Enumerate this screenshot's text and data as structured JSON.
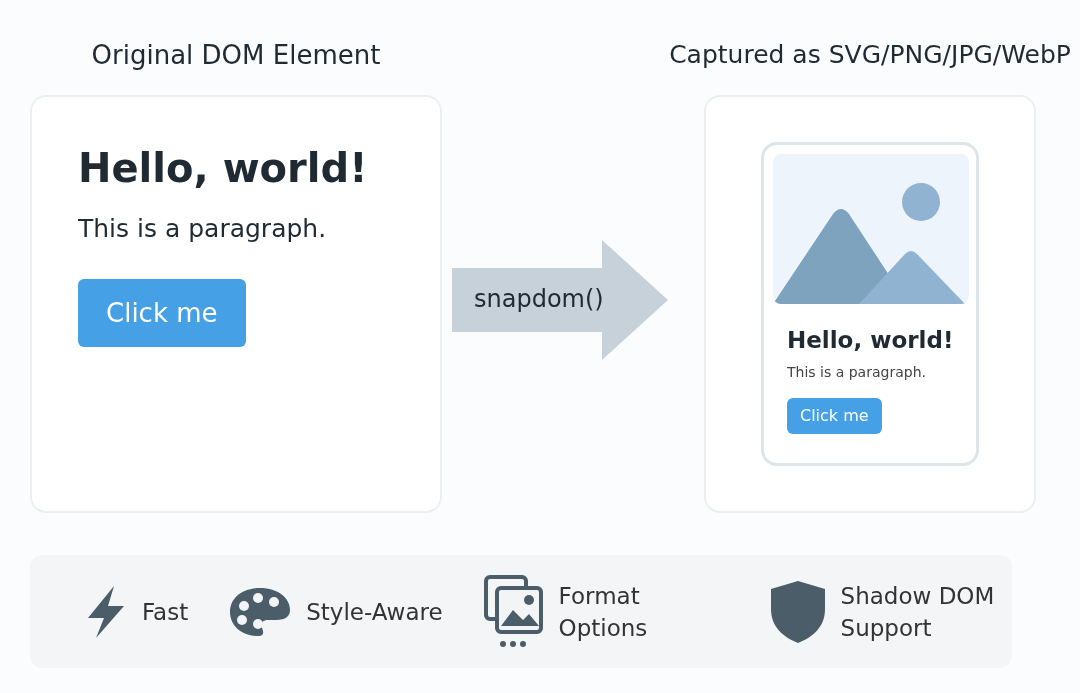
{
  "original": {
    "title": "Original DOM Element",
    "heading": "Hello, world!",
    "paragraph": "This is a paragraph.",
    "button": "Click me"
  },
  "arrow": {
    "label": "snapdom()"
  },
  "captured": {
    "title": "Captured as SVG/PNG/JPG/WebP",
    "heading": "Hello, world!",
    "paragraph": "This is a paragraph.",
    "button": "Click me"
  },
  "features": [
    {
      "kind": "bolt",
      "label": "Fast"
    },
    {
      "kind": "palette",
      "label": "Style-Aware"
    },
    {
      "kind": "images",
      "label": "Format Options"
    },
    {
      "kind": "shield",
      "label": "Shadow DOM Support"
    }
  ]
}
